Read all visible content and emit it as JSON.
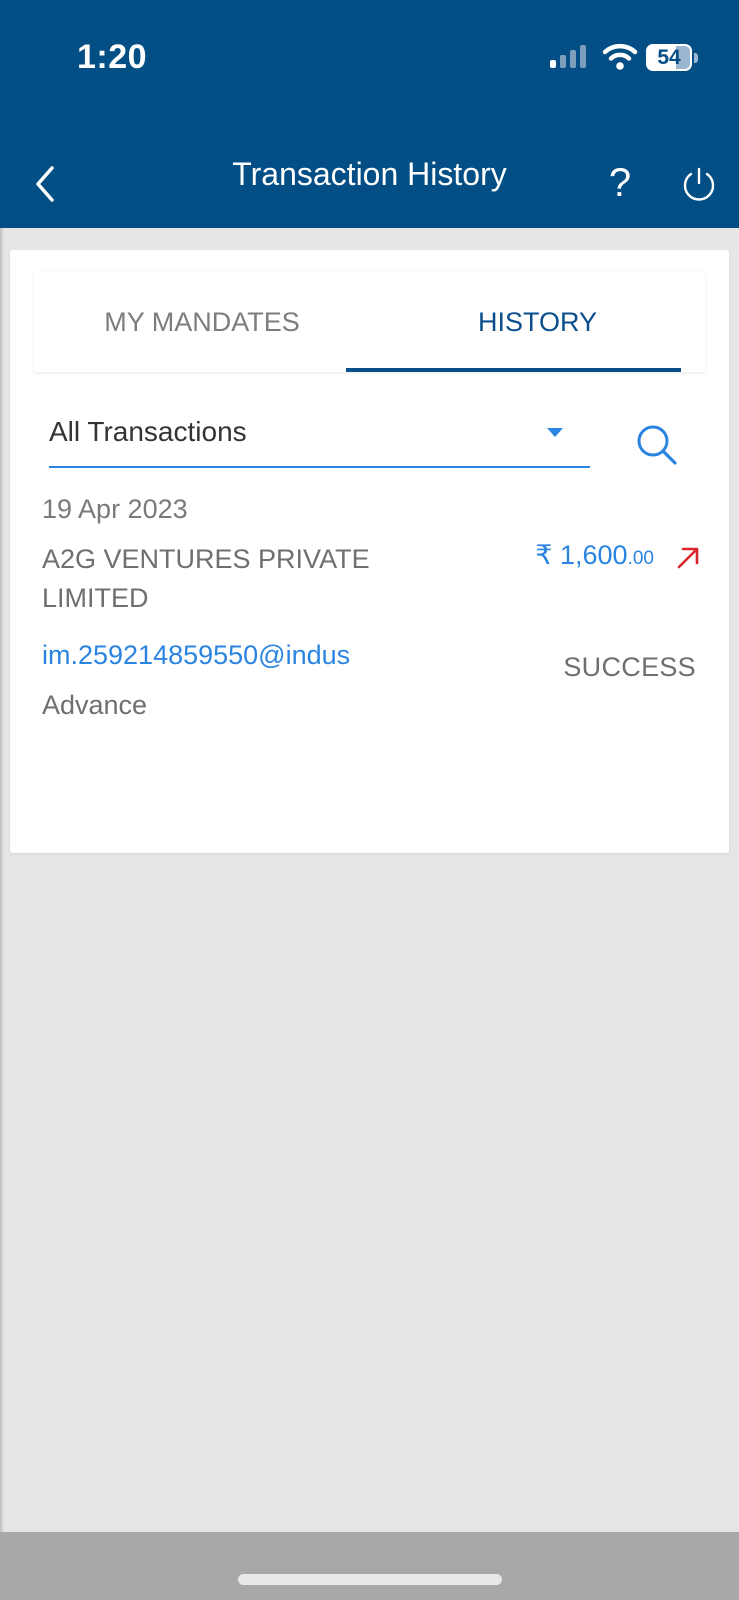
{
  "status_bar": {
    "time": "1:20",
    "battery": "54"
  },
  "header": {
    "title": "Transaction History",
    "help_label": "?",
    "icons": [
      "back-chevron-icon",
      "help-icon",
      "power-icon"
    ]
  },
  "tabs": [
    {
      "label": "MY MANDATES",
      "selected": false
    },
    {
      "label": "HISTORY",
      "selected": true
    }
  ],
  "filter": {
    "selected": "All Transactions"
  },
  "transactions": [
    {
      "date": "19 Apr 2023",
      "payee": "A2G VENTURES PRIVATE LIMITED",
      "currency": "₹",
      "amount_whole": "1,600",
      "amount_decimals": ".00",
      "direction_icon": "debit-arrow-icon",
      "vpa": "im.259214859550@indus",
      "status": "SUCCESS",
      "remark": "Advance"
    }
  ],
  "colors": {
    "header_bg": "#034e84",
    "accent_blue": "#2b84e0",
    "tab_active": "#0a4f8c",
    "debit_red": "#d9262c",
    "page_bg": "#e6e6e6"
  }
}
